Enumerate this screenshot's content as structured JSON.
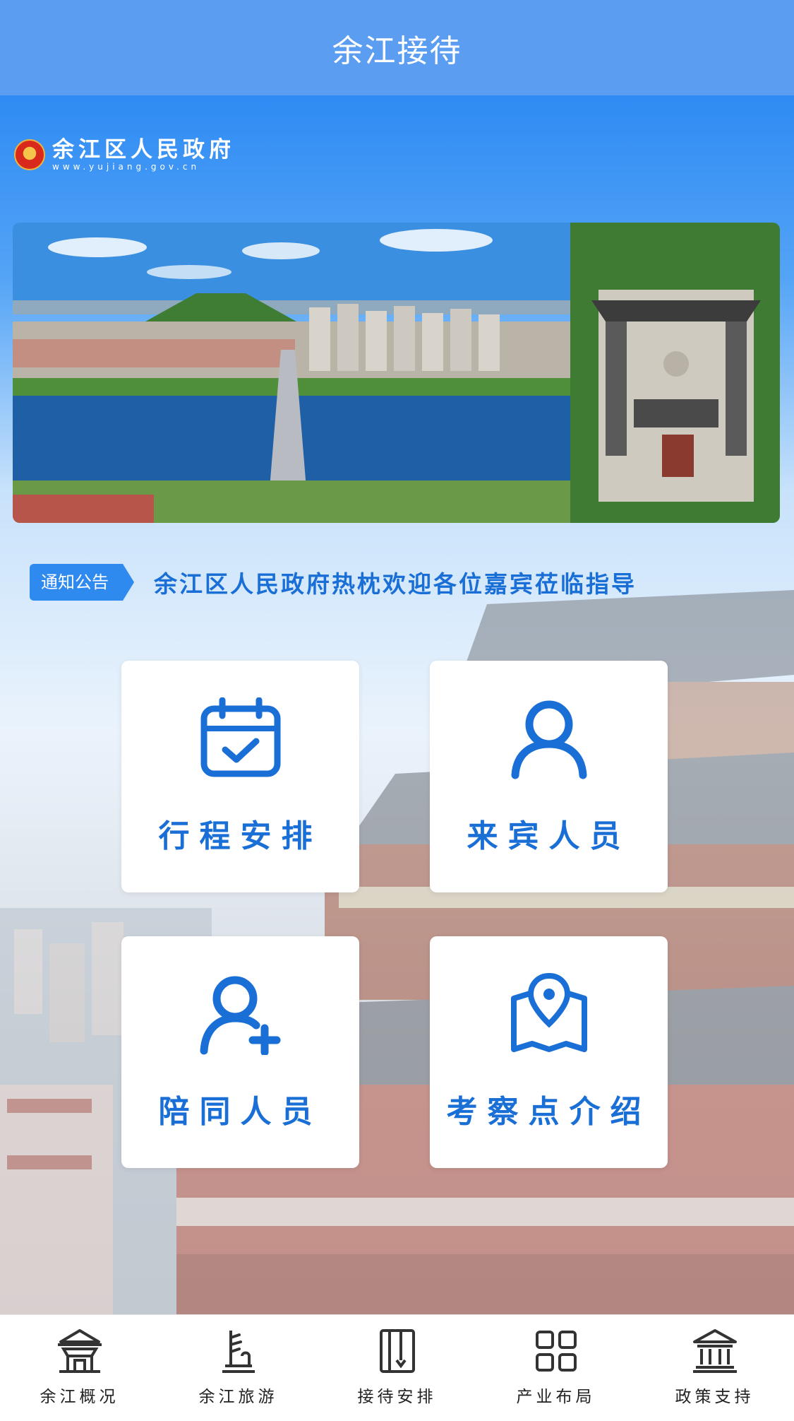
{
  "header": {
    "title": "余江接待"
  },
  "brand": {
    "name": "余江区人民政府",
    "url": "www.yujiang.gov.cn"
  },
  "notice": {
    "tag": "通知公告",
    "text": "余江区人民政府热枕欢迎各位嘉宾莅临指导"
  },
  "cards": [
    {
      "label": "行程安排",
      "icon": "calendar-check-icon"
    },
    {
      "label": "来宾人员",
      "icon": "person-icon"
    },
    {
      "label": "陪同人员",
      "icon": "person-add-icon"
    },
    {
      "label": "考察点介绍",
      "icon": "map-pin-icon"
    }
  ],
  "tabs": [
    {
      "label": "余江概况",
      "icon": "pavilion-icon"
    },
    {
      "label": "余江旅游",
      "icon": "tourism-icon"
    },
    {
      "label": "接待安排",
      "icon": "book-icon"
    },
    {
      "label": "产业布局",
      "icon": "grid-icon"
    },
    {
      "label": "政策支持",
      "icon": "government-building-icon"
    }
  ],
  "colors": {
    "header": "#5b9df0",
    "accent": "#1a6fd6",
    "notice_tag": "#2f8af0"
  }
}
